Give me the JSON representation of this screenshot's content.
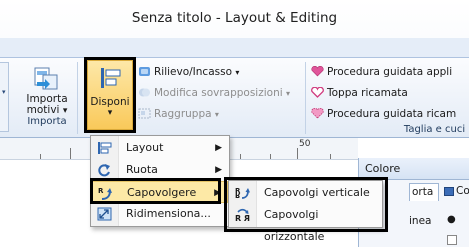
{
  "window": {
    "title": "Senza titolo - Layout & Editing"
  },
  "ribbon": {
    "import_button": {
      "line1": "Importa",
      "line2": "motivi",
      "arrow": "▾"
    },
    "import_group_label": "Importa",
    "arrange_button": {
      "label": "Disponi",
      "arrow": "▾"
    },
    "edit_items": {
      "relief": "Rilievo/Incasso",
      "modify_overlap": "Modifica sovrapposizioni",
      "group": "Raggruppa",
      "dropdown_arrow": "▾"
    },
    "cut_items": {
      "guided1": "Procedura guidata appli",
      "patch": "Toppa ricamata",
      "guided2": "Procedura guidata ricam"
    },
    "cut_group_label": "Taglia e cuci"
  },
  "ruler": {
    "label_50": "50"
  },
  "panel": {
    "title": "Colore",
    "tab1": "orta",
    "tab2": "Co",
    "row_label": "inea",
    "radio": "●"
  },
  "arrange_menu": {
    "items": [
      {
        "label": "Layout",
        "icon": "layout-icon",
        "submenu": true
      },
      {
        "label": "Ruota",
        "icon": "rotate-icon",
        "submenu": true
      },
      {
        "label": "Capovolgere",
        "icon": "flip-icon",
        "submenu": true,
        "highlighted": true
      },
      {
        "label": "Ridimensiona...",
        "icon": "resize-icon",
        "submenu": false
      }
    ],
    "submenu_arrow": "▶"
  },
  "flip_submenu": {
    "items": [
      {
        "label": "Capovolgi verticale",
        "icon": "flip-vertical-icon"
      },
      {
        "label": "Capovolgi orizzontale",
        "icon": "flip-horizontal-icon"
      }
    ]
  }
}
